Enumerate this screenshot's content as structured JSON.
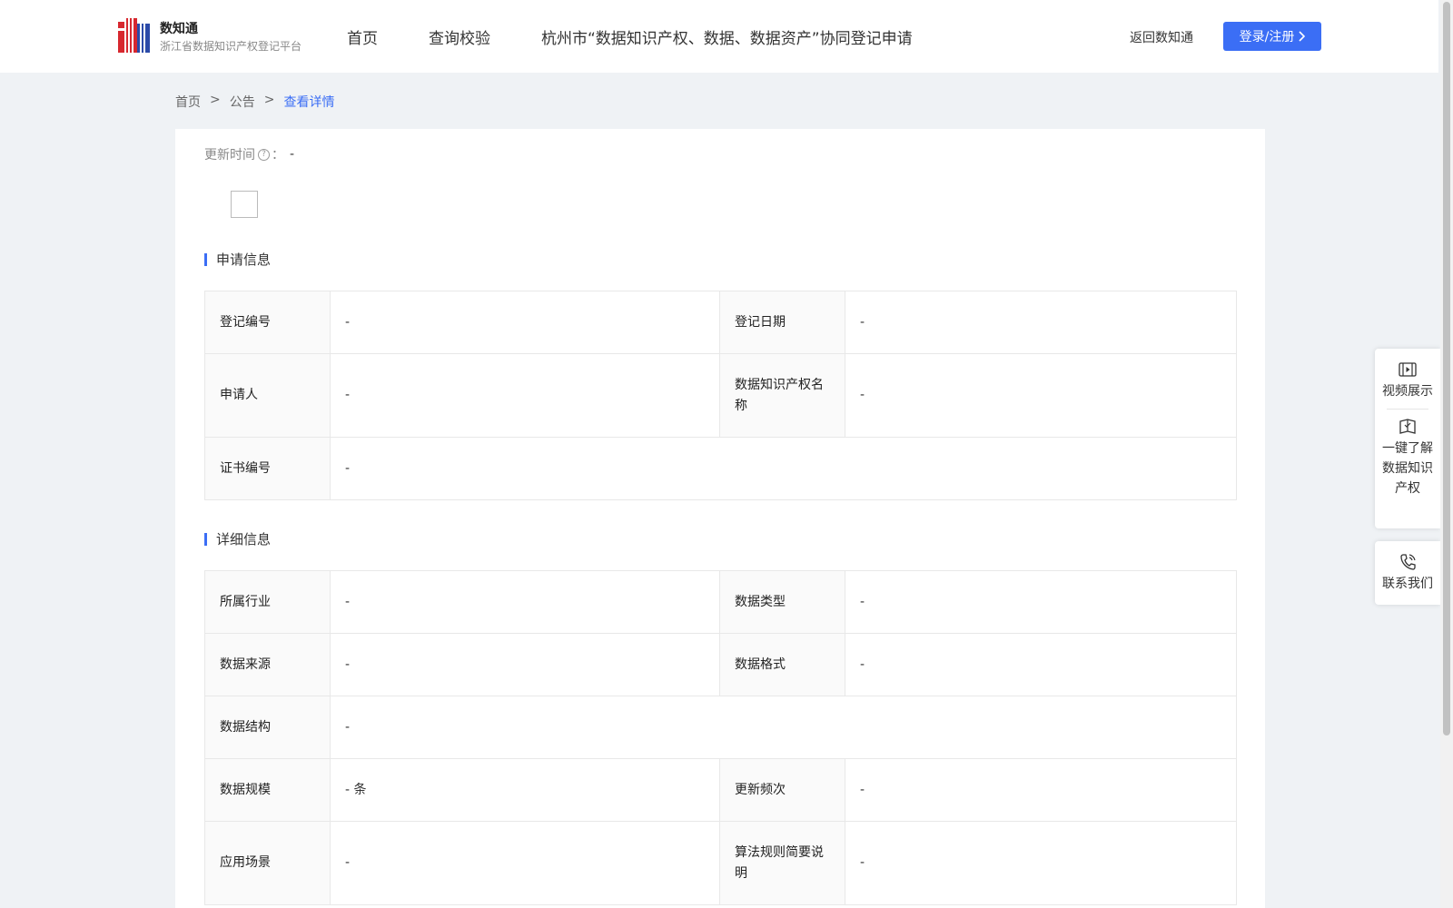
{
  "header": {
    "brand_name": "数知通",
    "brand_sub": "浙江省数据知识产权登记平台",
    "nav": [
      "首页",
      "查询校验",
      "杭州市“数据知识产权、数据、数据资产”协同登记申请"
    ],
    "back_link": "返回数知通",
    "login_label": "登录/注册"
  },
  "breadcrumb": {
    "home": "首页",
    "sep": ">",
    "notice": "公告",
    "current": "查看详情"
  },
  "update": {
    "label": "更新时间",
    "colon": "：",
    "value": "-"
  },
  "application": {
    "title": "申请信息",
    "reg_no_label": "登记编号",
    "reg_no": "-",
    "reg_date_label": "登记日期",
    "reg_date": "-",
    "applicant_label": "申请人",
    "applicant": "-",
    "ip_name_label": "数据知识产权名称",
    "ip_name": "-",
    "cert_no_label": "证书编号",
    "cert_no": "-"
  },
  "details": {
    "title": "详细信息",
    "industry_label": "所属行业",
    "industry": "-",
    "data_type_label": "数据类型",
    "data_type": "-",
    "source_label": "数据来源",
    "source": "-",
    "format_label": "数据格式",
    "format": "-",
    "structure_label": "数据结构",
    "structure": "-",
    "scale_label": "数据规模",
    "scale": "- 条",
    "frequency_label": "更新频次",
    "frequency": "-",
    "scenario_label": "应用场景",
    "scenario": "-",
    "algorithm_label": "算法规则简要说明",
    "algorithm": "-"
  },
  "float_panel": {
    "video": "视频展示",
    "learn": "一键了解数据知识产权",
    "contact": "联系我们"
  },
  "colors": {
    "accent": "#3b6ef5",
    "logo_red": "#d7282f",
    "logo_blue": "#2b4aa8"
  }
}
